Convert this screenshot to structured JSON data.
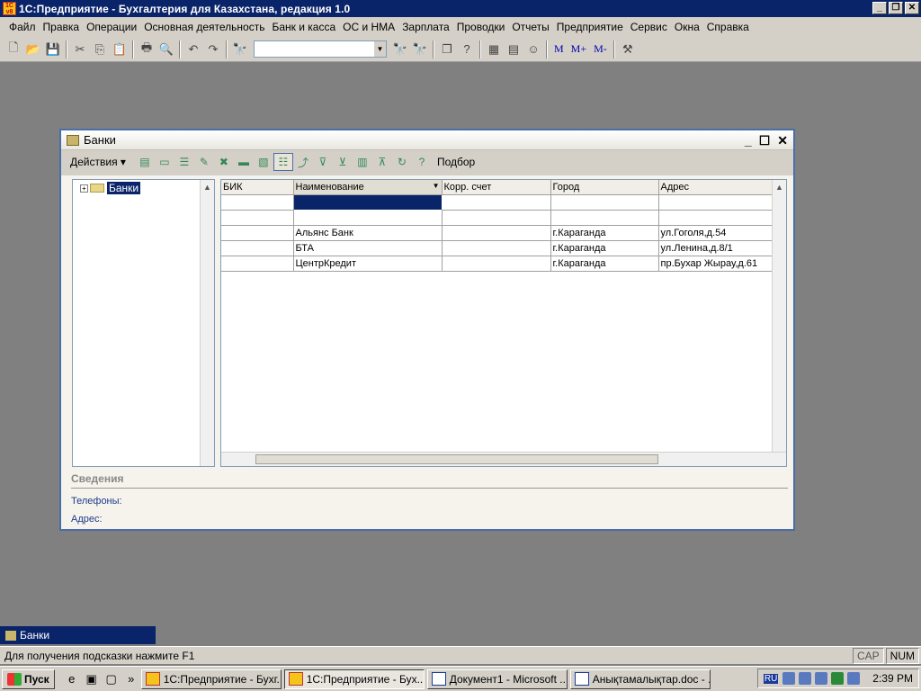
{
  "app": {
    "title": "1С:Предприятие - Бухгалтерия для Казахстана, редакция 1.0"
  },
  "menu": [
    "Файл",
    "Правка",
    "Операции",
    "Основная деятельность",
    "Банк и касса",
    "ОС и НМА",
    "Зарплата",
    "Проводки",
    "Отчеты",
    "Предприятие",
    "Сервис",
    "Окна",
    "Справка"
  ],
  "toolbar": {
    "search_value": "",
    "m_buttons": [
      "M",
      "M+",
      "M-"
    ]
  },
  "window": {
    "title": "Банки",
    "actions_label": "Действия",
    "podbor_label": "Подбор",
    "tree_root": "Банки",
    "columns": [
      "БИК",
      "Наименование",
      "Корр. счет",
      "Город",
      "Адрес"
    ],
    "rows": [
      [
        "",
        "",
        "",
        "",
        ""
      ],
      [
        "",
        "",
        "",
        "",
        ""
      ],
      [
        "",
        "Альянс Банк",
        "",
        "г.Караганда",
        "ул.Гоголя,д.54"
      ],
      [
        "",
        "БТА",
        "",
        "г.Караганда",
        "ул.Ленина,д.8/1"
      ],
      [
        "",
        "ЦентрКредит",
        "",
        "г.Караганда",
        "пр.Бухар Жырау,д.61"
      ]
    ],
    "info_title": "Сведения",
    "phones_label": "Телефоны:",
    "address_label": "Адрес:"
  },
  "taskwindow": {
    "item": "Банки"
  },
  "status": {
    "hint": "Для получения подсказки нажмите F1",
    "cap": "CAP",
    "num": "NUM"
  },
  "taskbar": {
    "start": "Пуск",
    "buttons": [
      "1С:Предприятие - Бухг...",
      "1С:Предприятие - Бух...",
      "Документ1 - Microsoft ...",
      "Анықтамалықтар.doc - ..."
    ],
    "lang": "RU",
    "clock": "2:39 PM"
  }
}
